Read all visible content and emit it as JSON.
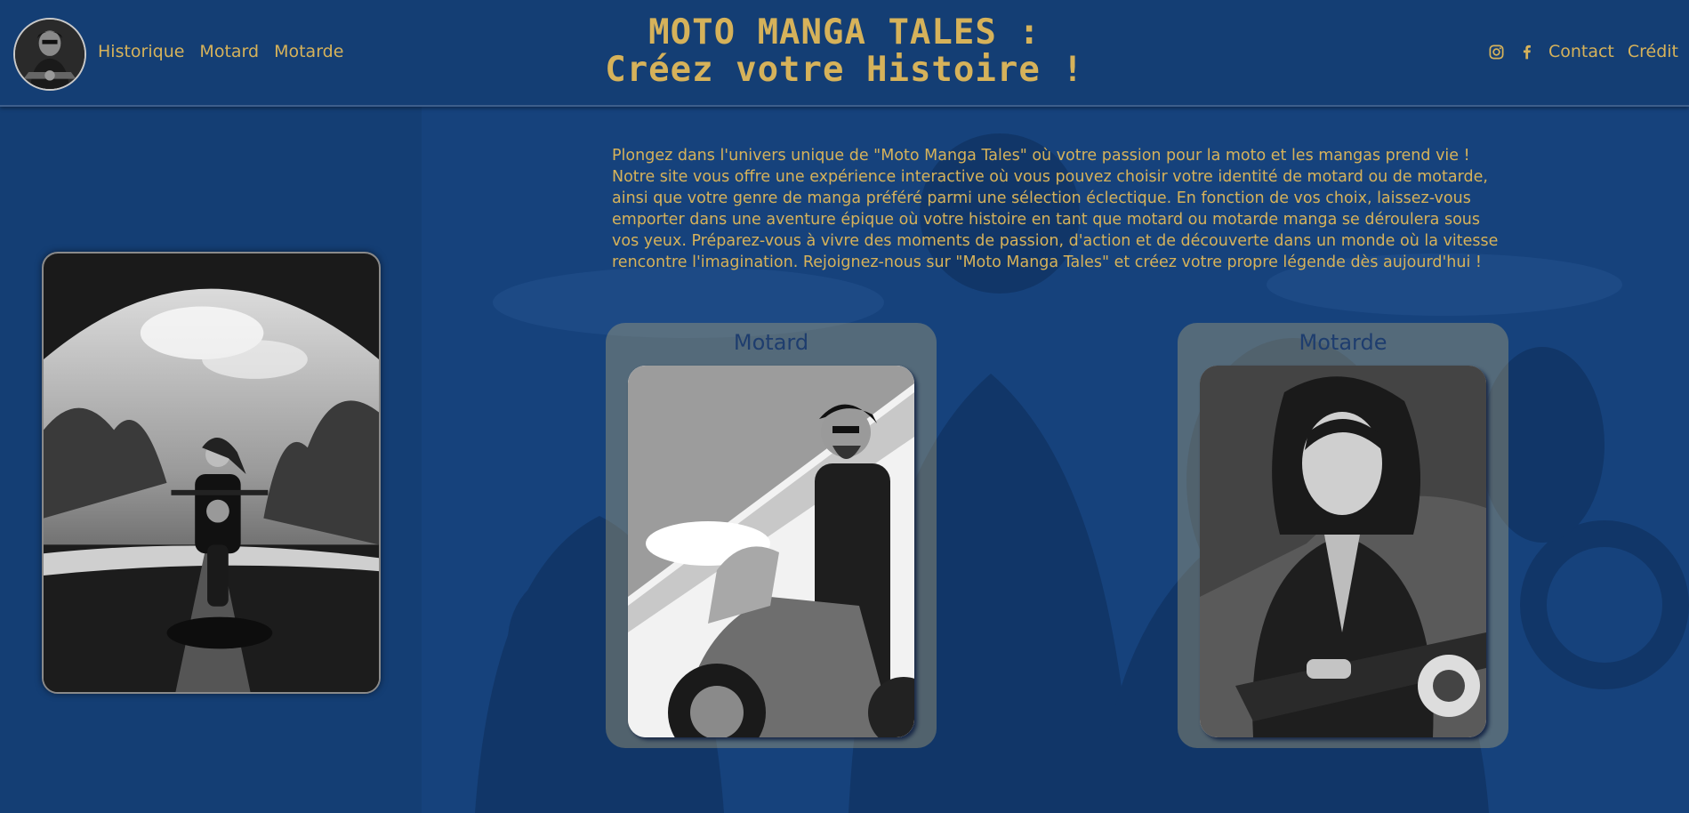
{
  "header": {
    "title_line1": "MOTO MANGA TALES :",
    "title_line2": "Créez votre Histoire !",
    "nav_left": [
      "Historique",
      "Motard",
      "Motarde"
    ],
    "nav_right": [
      "Contact",
      "Crédit"
    ],
    "social_icons": [
      "instagram-icon",
      "facebook-icon"
    ]
  },
  "intro": {
    "text": "Plongez dans l'univers unique de \"Moto Manga Tales\" où votre passion pour la moto et les mangas prend vie ! Notre site vous offre une expérience interactive où vous pouvez choisir votre identité de motard ou de motarde, ainsi que votre genre de manga préféré parmi une sélection éclectique. En fonction de vos choix, laissez-vous emporter dans une aventure épique où votre histoire en tant que motard ou motarde manga se déroulera sous vos yeux. Préparez-vous à vivre des moments de passion, d'action et de découverte dans un monde où la vitesse rencontre l'imagination. Rejoignez-nous sur \"Moto Manga Tales\" et créez votre propre légende dès aujourd'hui !"
  },
  "choices": [
    {
      "label": "Motard"
    },
    {
      "label": "Motarde"
    }
  ],
  "colors": {
    "background": "#143e74",
    "accent_gold": "#d6b25a",
    "card_label": "#1e3d6e"
  }
}
